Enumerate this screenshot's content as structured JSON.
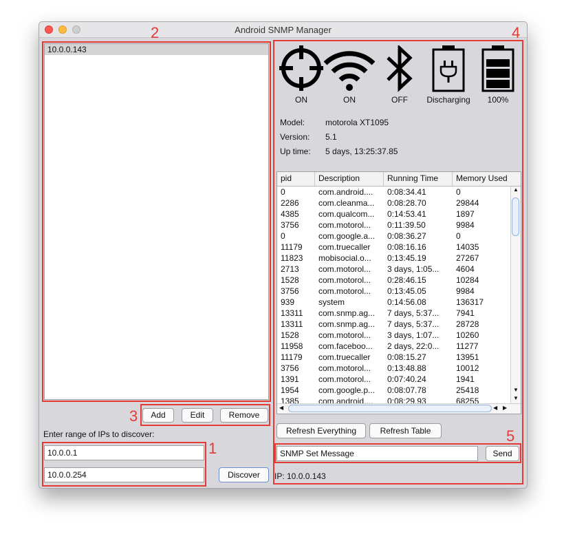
{
  "window": {
    "title": "Android SNMP Manager"
  },
  "annotations": {
    "a1": "1",
    "a2": "2",
    "a3": "3",
    "a4": "4",
    "a5": "5"
  },
  "device_list": {
    "items": [
      "10.0.0.143"
    ]
  },
  "buttons": {
    "add": "Add",
    "edit": "Edit",
    "remove": "Remove",
    "discover": "Discover",
    "refresh_everything": "Refresh Everything",
    "refresh_table": "Refresh Table",
    "send": "Send"
  },
  "discover": {
    "label": "Enter range of IPs to discover:",
    "start_ip": "10.0.0.1",
    "end_ip": "10.0.0.254"
  },
  "status": {
    "gps": {
      "icon": "crosshair-icon",
      "state": "ON"
    },
    "wifi": {
      "icon": "wifi-icon",
      "state": "ON"
    },
    "bluetooth": {
      "icon": "bluetooth-icon",
      "state": "OFF"
    },
    "power": {
      "icon": "plug-battery-icon",
      "state": "Discharging"
    },
    "battery": {
      "icon": "battery-icon",
      "state": "100%",
      "level": 1.0
    }
  },
  "device_info": {
    "model_label": "Model:",
    "model": "motorola XT1095",
    "version_label": "Version:",
    "version": "5.1",
    "uptime_label": "Up time:",
    "uptime": "5 days, 13:25:37.85"
  },
  "process_table": {
    "columns": [
      "pid",
      "Description",
      "Running Time",
      "Memory Used"
    ],
    "rows": [
      [
        "0",
        "com.android....",
        "0:08:34.41",
        "0"
      ],
      [
        "2286",
        "com.cleanma...",
        "0:08:28.70",
        "29844"
      ],
      [
        "4385",
        "com.qualcom...",
        "0:14:53.41",
        "1897"
      ],
      [
        "3756",
        "com.motorol...",
        "0:11:39.50",
        "9984"
      ],
      [
        "0",
        "com.google.a...",
        "0:08:36.27",
        "0"
      ],
      [
        "11179",
        "com.truecaller",
        "0:08:16.16",
        "14035"
      ],
      [
        "11823",
        "mobisocial.o...",
        "0:13:45.19",
        "27267"
      ],
      [
        "2713",
        "com.motorol...",
        "3 days, 1:05...",
        "4604"
      ],
      [
        "1528",
        "com.motorol...",
        "0:28:46.15",
        "10284"
      ],
      [
        "3756",
        "com.motorol...",
        "0:13:45.05",
        "9984"
      ],
      [
        "939",
        "system",
        "0:14:56.08",
        "136317"
      ],
      [
        "13311",
        "com.snmp.ag...",
        "7 days, 5:37...",
        "7941"
      ],
      [
        "13311",
        "com.snmp.ag...",
        "7 days, 5:37...",
        "28728"
      ],
      [
        "1528",
        "com.motorol...",
        "3 days, 1:07...",
        "10260"
      ],
      [
        "11958",
        "com.faceboo...",
        "2 days, 22:0...",
        "11277"
      ],
      [
        "11179",
        "com.truecaller",
        "0:08:15.27",
        "13951"
      ],
      [
        "3756",
        "com.motorol...",
        "0:13:48.88",
        "10012"
      ],
      [
        "1391",
        "com.motorol...",
        "0:07:40.24",
        "1941"
      ],
      [
        "1954",
        "com.google.p...",
        "0:08:07.78",
        "25418"
      ],
      [
        "1385",
        "com.android....",
        "0:08:29.93",
        "68255"
      ]
    ]
  },
  "snmp": {
    "message": "SNMP Set Message"
  },
  "footer": {
    "ip_text": "IP: 10.0.0.143"
  },
  "colors": {
    "annotation": "#e53935",
    "selection": "#d4d4d4",
    "window_bg": "#d8d8dc"
  }
}
